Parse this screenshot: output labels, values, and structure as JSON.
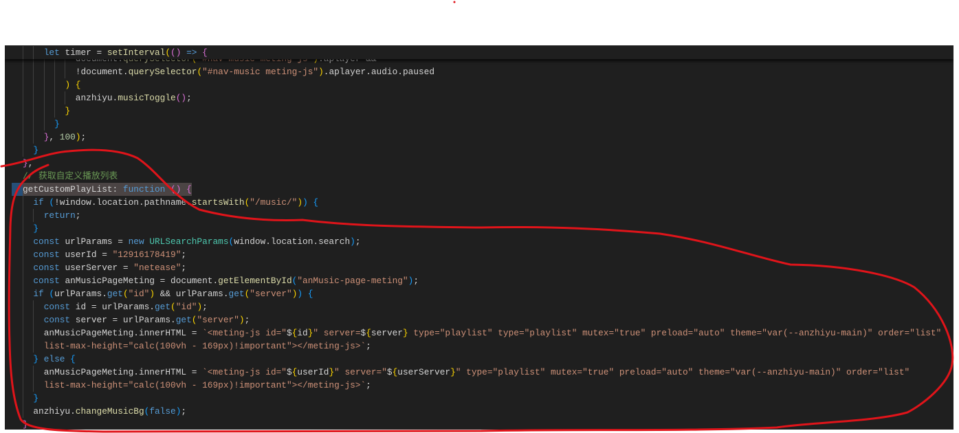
{
  "editor": {
    "theme": "dark",
    "colors": {
      "background": "#1f1f1f",
      "keyword": "#569cd6",
      "string": "#ce9178",
      "function": "#dcdcaa",
      "comment": "#6a9955",
      "annotation": "#e0141a"
    },
    "sticky_line": {
      "level": 2,
      "tokens": [
        [
          "let ",
          "k"
        ],
        [
          "timer = ",
          "v"
        ],
        [
          "setInterval",
          "f"
        ],
        [
          "(",
          "b1"
        ],
        [
          "() ",
          "b2"
        ],
        [
          "=> ",
          "k"
        ],
        [
          "{",
          "b2"
        ]
      ]
    },
    "lines": [
      {
        "level": 5,
        "tokens": [
          [
            "document.",
            "v"
          ],
          [
            "querySelector",
            "f"
          ],
          [
            "(",
            "b1"
          ],
          [
            "\"#nav-music meting-js\"",
            "s"
          ],
          [
            ")",
            "b1"
          ],
          [
            ".aplayer &&",
            "v"
          ]
        ]
      },
      {
        "level": 5,
        "tokens": [
          [
            "!document.",
            "v"
          ],
          [
            "querySelector",
            "f"
          ],
          [
            "(",
            "b1"
          ],
          [
            "\"#nav-music meting-js\"",
            "s"
          ],
          [
            ")",
            "b1"
          ],
          [
            ".aplayer.audio.paused",
            "v"
          ]
        ]
      },
      {
        "level": 4,
        "tokens": [
          [
            ") {",
            "b1"
          ]
        ]
      },
      {
        "level": 5,
        "tokens": [
          [
            "anzhiyu.",
            "v"
          ],
          [
            "musicToggle",
            "f"
          ],
          [
            "()",
            "b2"
          ],
          [
            ";",
            "v"
          ]
        ]
      },
      {
        "level": 4,
        "tokens": [
          [
            "}",
            "b1"
          ]
        ]
      },
      {
        "level": 3,
        "tokens": [
          [
            "}",
            "b3"
          ]
        ]
      },
      {
        "level": 2,
        "tokens": [
          [
            "}",
            "b2"
          ],
          [
            ", ",
            "v"
          ],
          [
            "100",
            "n"
          ],
          [
            ")",
            "b1"
          ],
          [
            ";",
            "v"
          ]
        ]
      },
      {
        "level": 1,
        "tokens": [
          [
            "}",
            "b3"
          ]
        ]
      },
      {
        "level": 0,
        "tokens": [
          [
            "}",
            "b2"
          ],
          [
            ",",
            "v"
          ]
        ]
      },
      {
        "level": 0,
        "tokens": [
          [
            "// 获取自定义播放列表",
            "c"
          ]
        ]
      },
      {
        "level": 0,
        "selected": true,
        "tokens": [
          [
            "getCustomPlayList: ",
            "v"
          ],
          [
            "function ",
            "k"
          ],
          [
            "() ",
            "b2"
          ],
          [
            "{",
            "b2"
          ]
        ]
      },
      {
        "level": 1,
        "tokens": [
          [
            "if ",
            "k"
          ],
          [
            "(",
            "b3"
          ],
          [
            "!window.location.pathname.",
            "v"
          ],
          [
            "startsWith",
            "f"
          ],
          [
            "(",
            "b1"
          ],
          [
            "\"/music/\"",
            "s"
          ],
          [
            ")",
            "b1"
          ],
          [
            ") ",
            "b3"
          ],
          [
            "{",
            "b3"
          ]
        ]
      },
      {
        "level": 2,
        "tokens": [
          [
            "return",
            "k"
          ],
          [
            ";",
            "v"
          ]
        ]
      },
      {
        "level": 1,
        "tokens": [
          [
            "}",
            "b3"
          ]
        ]
      },
      {
        "level": 1,
        "tokens": [
          [
            "const ",
            "k"
          ],
          [
            "urlParams = ",
            "v"
          ],
          [
            "new ",
            "k"
          ],
          [
            "URLSearchParams",
            "t"
          ],
          [
            "(",
            "b3"
          ],
          [
            "window.location.search",
            "v"
          ],
          [
            ")",
            "b3"
          ],
          [
            ";",
            "v"
          ]
        ]
      },
      {
        "level": 1,
        "tokens": [
          [
            "const ",
            "k"
          ],
          [
            "userId = ",
            "v"
          ],
          [
            "\"12916178419\"",
            "s"
          ],
          [
            ";",
            "v"
          ]
        ]
      },
      {
        "level": 1,
        "tokens": [
          [
            "const ",
            "k"
          ],
          [
            "userServer = ",
            "v"
          ],
          [
            "\"netease\"",
            "s"
          ],
          [
            ";",
            "v"
          ]
        ]
      },
      {
        "level": 1,
        "tokens": [
          [
            "const ",
            "k"
          ],
          [
            "anMusicPageMeting = document.",
            "v"
          ],
          [
            "getElementById",
            "f"
          ],
          [
            "(",
            "b3"
          ],
          [
            "\"anMusic-page-meting\"",
            "s"
          ],
          [
            ")",
            "b3"
          ],
          [
            ";",
            "v"
          ]
        ]
      },
      {
        "level": 1,
        "tokens": [
          [
            "if ",
            "k"
          ],
          [
            "(",
            "b3"
          ],
          [
            "urlParams.",
            "v"
          ],
          [
            "get",
            "k"
          ],
          [
            "(",
            "b1"
          ],
          [
            "\"id\"",
            "s"
          ],
          [
            ")",
            "b1"
          ],
          [
            " && urlParams.",
            "v"
          ],
          [
            "get",
            "k"
          ],
          [
            "(",
            "b1"
          ],
          [
            "\"server\"",
            "s"
          ],
          [
            ")",
            "b1"
          ],
          [
            ") ",
            "b3"
          ],
          [
            "{",
            "b3"
          ]
        ]
      },
      {
        "level": 2,
        "tokens": [
          [
            "const ",
            "k"
          ],
          [
            "id = urlParams.",
            "v"
          ],
          [
            "get",
            "k"
          ],
          [
            "(",
            "b1"
          ],
          [
            "\"id\"",
            "s"
          ],
          [
            ")",
            "b1"
          ],
          [
            ";",
            "v"
          ]
        ]
      },
      {
        "level": 2,
        "tokens": [
          [
            "const ",
            "k"
          ],
          [
            "server = urlParams.",
            "v"
          ],
          [
            "get",
            "k"
          ],
          [
            "(",
            "b1"
          ],
          [
            "\"server\"",
            "s"
          ],
          [
            ")",
            "b1"
          ],
          [
            ";",
            "v"
          ]
        ]
      },
      {
        "level": 2,
        "tokens": [
          [
            "anMusicPageMeting.innerHTML = ",
            "v"
          ],
          [
            "`<meting-js id=\"",
            "s"
          ],
          [
            "$",
            "v"
          ],
          [
            "{",
            "b1"
          ],
          [
            "id",
            "v"
          ],
          [
            "}",
            "b1"
          ],
          [
            "\" server=",
            "s"
          ],
          [
            "$",
            "v"
          ],
          [
            "{",
            "b1"
          ],
          [
            "server",
            "v"
          ],
          [
            "}",
            "b1"
          ],
          [
            " type=\"playlist\" type=\"playlist\" mutex=\"true\" preload=\"auto\" theme=\"var(--anzhiyu-main)\" order=\"list\"",
            "s"
          ]
        ]
      },
      {
        "level": 2,
        "tokens": [
          [
            "list-max-height=\"calc(100vh - 169px)!important\"></meting-js>`",
            "s"
          ],
          [
            ";",
            "v"
          ]
        ]
      },
      {
        "level": 1,
        "tokens": [
          [
            "} ",
            "b3"
          ],
          [
            "else ",
            "k"
          ],
          [
            "{",
            "b3"
          ]
        ]
      },
      {
        "level": 2,
        "tokens": [
          [
            "anMusicPageMeting.innerHTML = ",
            "v"
          ],
          [
            "`<meting-js id=\"",
            "s"
          ],
          [
            "$",
            "v"
          ],
          [
            "{",
            "b1"
          ],
          [
            "userId",
            "v"
          ],
          [
            "}",
            "b1"
          ],
          [
            "\" server=\"",
            "s"
          ],
          [
            "$",
            "v"
          ],
          [
            "{",
            "b1"
          ],
          [
            "userServer",
            "v"
          ],
          [
            "}",
            "b1"
          ],
          [
            "\" type=\"playlist\" mutex=\"true\" preload=\"auto\" theme=\"var(--anzhiyu-main)\" order=\"list\"",
            "s"
          ]
        ]
      },
      {
        "level": 2,
        "tokens": [
          [
            "list-max-height=\"calc(100vh - 169px)!important\"></meting-js>`",
            "s"
          ],
          [
            ";",
            "v"
          ]
        ]
      },
      {
        "level": 1,
        "tokens": [
          [
            "}",
            "b3"
          ]
        ]
      },
      {
        "level": 1,
        "tokens": [
          [
            "anzhiyu.",
            "v"
          ],
          [
            "changeMusicBg",
            "f"
          ],
          [
            "(",
            "b3"
          ],
          [
            "false",
            "k"
          ],
          [
            ")",
            "b3"
          ],
          [
            ";",
            "v"
          ]
        ]
      },
      {
        "level": 0,
        "tokens": [
          [
            "}",
            "b2"
          ]
        ]
      }
    ]
  }
}
